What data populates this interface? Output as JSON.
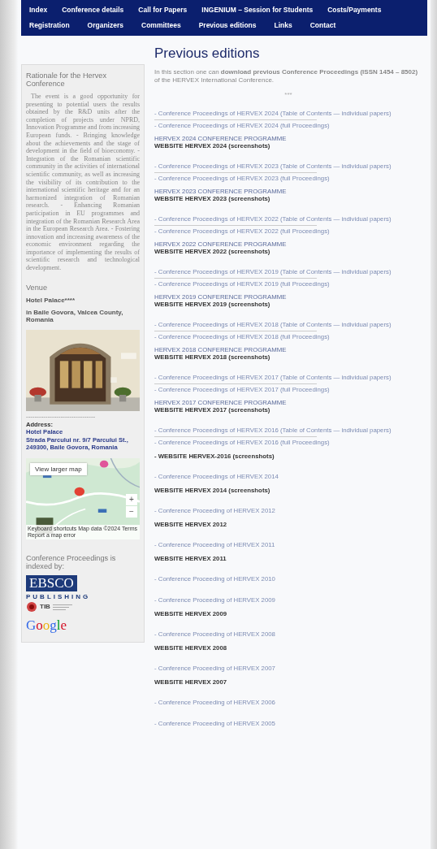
{
  "nav_rows": [
    [
      {
        "label": "Index",
        "selected": false
      },
      {
        "label": "Conference details",
        "selected": false
      },
      {
        "label": "Call for Papers",
        "selected": false
      },
      {
        "label": "INGENIUM – Session for Students",
        "selected": false
      },
      {
        "label": "Costs/Payments",
        "selected": false
      }
    ],
    [
      {
        "label": "Registration",
        "selected": false
      },
      {
        "label": "Organizers",
        "selected": false
      },
      {
        "label": "Committees",
        "selected": false
      },
      {
        "label": "Previous editions",
        "selected": false
      },
      {
        "label": "Links",
        "selected": false
      },
      {
        "label": "Contact",
        "selected": false
      }
    ]
  ],
  "sidebar": {
    "rationale": {
      "title": "Rationale for the Hervex Conference",
      "text": "The event is a good opportunity for presenting to potential users the results obtained by the R&D units after the completion of projects under NPRD, Innovation Programme and from increasing European funds. - Bringing knowledge about the achievements and the stage of development in the field of bioeconomy. - Integration of the Romanian scientific community in the activities of international scientific community, as well as increasing the visibility of its contribution to the international scientific heritage and for an harmonized integration of Romanian research. - Enhancing Romanian participation in EU programmes and integration of the Romanian Research Area in the European Research Area. - Fostering innovation and increasing awareness of the economic environment regarding the importance of implementing the results of scientific research and technological development."
    },
    "venue": {
      "title": "Venue",
      "hotel": "Hotel Palace****",
      "location": "in Baile Govora, Valcea County, Romania",
      "separator": "--------------------------------",
      "address_label": "Address:",
      "address_lines": [
        "Hotel Palace",
        "Strada Parcului nr. 9/7 Parcului St.,",
        "249300, Baile Govora, Romania"
      ]
    },
    "map": {
      "button": "View larger map",
      "zoom_in": "+",
      "zoom_out": "−",
      "footer": "Keyboard shortcuts   Map data ©2024   Terms   Report a map error"
    },
    "indexed": {
      "title": "Conference Proceedings is indexed by:",
      "logos": [
        {
          "kind": "ebsco",
          "name": "EBSCO",
          "sub": "PUBLISHING"
        },
        {
          "kind": "tib",
          "name": "TIB"
        },
        {
          "kind": "google",
          "name": "Google"
        }
      ]
    }
  },
  "main": {
    "title": "Previous editions",
    "intro": "In this section one can **download previous Conference Proceedings (ISSN 1454 – 8502)** of the HERVEX International Conference.",
    "divider": "***",
    "editions": [
      {
        "links": [
          "- Conference Proceedings of HERVEX 2024 (Table of Contents — individual papers)",
          "- Conference Proceedings of HERVEX 2024 (full Proceedings)"
        ],
        "program": "HERVEX 2024 CONFERENCE PROGRAMME",
        "website": "WEBSITE HERVEX 2024 (screenshots)"
      },
      {
        "links": [
          "- Conference Proceedings of HERVEX 2023 (Table of Contents — individual papers)",
          "- Conference Proceedings of HERVEX 2023 (full Proceedings)"
        ],
        "program": "HERVEX 2023 CONFERENCE PROGRAMME",
        "website": "WEBSITE HERVEX 2023 (screenshots)"
      },
      {
        "links": [
          "- Conference Proceedings of HERVEX 2022 (Table of Contents — individual papers)",
          "- Conference Proceedings of HERVEX 2022 (full Proceedings)"
        ],
        "program": "HERVEX 2022 CONFERENCE PROGRAMME",
        "website": "WEBSITE HERVEX 2022 (screenshots)"
      },
      {
        "links": [
          "- Conference Proceedings of HERVEX 2019 (Table of Contents — individual papers)",
          "- Conference Proceedings of HERVEX 2019 (full Proceedings)"
        ],
        "program": "HERVEX 2019 CONFERENCE PROGRAMME",
        "website": "WEBSITE HERVEX 2019 (screenshots)"
      },
      {
        "links": [
          "- Conference Proceedings of HERVEX 2018 (Table of Contents — individual papers)",
          "- Conference Proceedings of HERVEX 2018 (full Proceedings)"
        ],
        "program": "HERVEX 2018 CONFERENCE PROGRAMME",
        "website": "WEBSITE HERVEX 2018 (screenshots)"
      },
      {
        "links": [
          "- Conference Proceedings of HERVEX 2017 (Table of Contents — individual papers)",
          "- Conference Proceedings of HERVEX 2017 (full Proceedings)"
        ],
        "program": "HERVEX 2017 CONFERENCE PROGRAMME",
        "website": "WEBSITE HERVEX 2017 (screenshots)"
      },
      {
        "links": [
          "- Conference Proceedings of HERVEX 2016 (Table of Contents — individual papers)",
          "- Conference Proceedings of HERVEX 2016 (full Proceedings)"
        ],
        "website": "- WEBSITE HERVEX-2016 (screenshots)"
      },
      {
        "links": [
          "- Conference Proceedings of HERVEX 2014"
        ],
        "website": "WEBSITE HERVEX 2014 (screenshots)"
      },
      {
        "links": [
          "- Conference Proceeding of HERVEX 2012"
        ],
        "website": "WEBSITE HERVEX 2012"
      },
      {
        "links": [
          "- Conference Proceeding of HERVEX 2011"
        ],
        "website": "WEBSITE HERVEX 2011"
      },
      {
        "links": [
          "- Conference Proceeding of HERVEX 2010"
        ]
      },
      {
        "links": [
          "- Conference Proceeding of HERVEX 2009"
        ],
        "website": "WEBSITE HERVEX 2009"
      },
      {
        "links": [
          "- Conference Proceeding of HERVEX 2008"
        ],
        "website": "WEBSITE HERVEX 2008"
      },
      {
        "links": [
          "- Conference Proceeding of HERVEX 2007"
        ],
        "website": "WEBSITE HERVEX 2007"
      },
      {
        "links": [
          "- Conference Proceeding of HERVEX 2006"
        ]
      },
      {
        "links": [
          "- Conference Proceeding of HERVEX 2005"
        ]
      }
    ]
  }
}
